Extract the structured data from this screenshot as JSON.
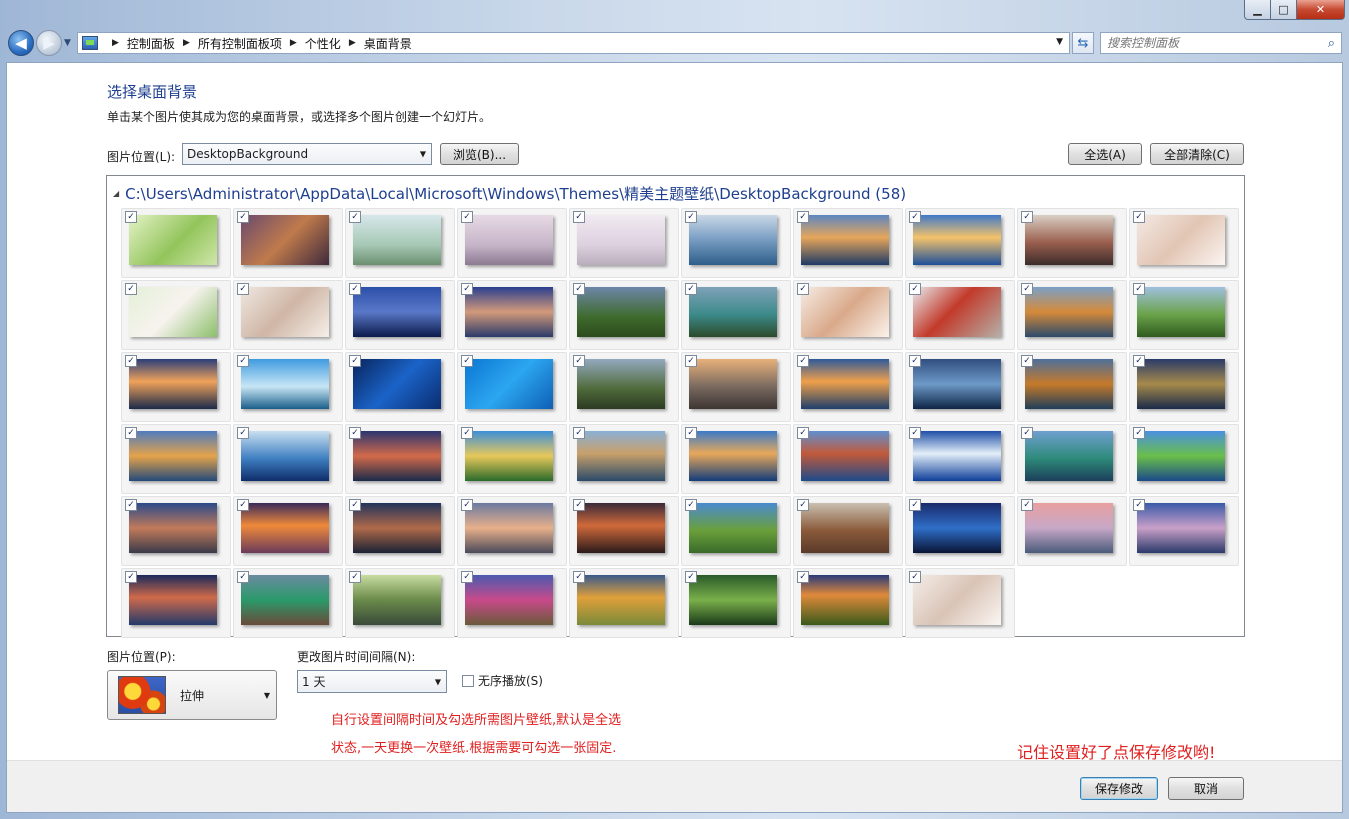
{
  "window": {
    "controls": {
      "minimize": "▁",
      "maximize": "□",
      "close": "✕"
    }
  },
  "nav": {
    "breadcrumbs": [
      "控制面板",
      "所有控制面板项",
      "个性化",
      "桌面背景"
    ],
    "search_placeholder": "搜索控制面板",
    "icons": {
      "back": "back-arrow-icon",
      "forward": "forward-arrow-icon",
      "refresh": "refresh-icon",
      "search": "search-icon"
    }
  },
  "page": {
    "title": "选择桌面背景",
    "subtitle": "单击某个图片使其成为您的桌面背景，或选择多个图片创建一个幻灯片。"
  },
  "location": {
    "label": "图片位置(L):",
    "value": "DesktopBackground",
    "browse": "浏览(B)...",
    "select_all": "全选(A)",
    "clear_all": "全部清除(C)"
  },
  "gallery": {
    "header": "C:\\Users\\Administrator\\AppData\\Local\\Microsoft\\Windows\\Themes\\精美主题壁纸\\DesktopBackground (58)",
    "count": 58,
    "checked": "✓",
    "thumbs": [
      "linear-gradient(135deg,#e4f3c6,#93c45c 55%,#cfe7a9)",
      "linear-gradient(135deg,#6a4a6e,#c07a4c 50%,#3f2a3c)",
      "linear-gradient(180deg,#d7e7ea,#a6c8b5 60%,#6b8f6f)",
      "linear-gradient(180deg,#e7d9e4,#c6b5c9 60%,#8b7a90)",
      "linear-gradient(180deg,#f1eaf1,#ddd0df 60%,#b9aebd)",
      "linear-gradient(180deg,#c9d7e6,#7fa2c6 45%,#2d5e8a)",
      "linear-gradient(180deg,#5d86c0,#e7a65a 45%,#1e3a66)",
      "linear-gradient(180deg,#3f79c8,#f5c36a 45%,#1c4f9a)",
      "linear-gradient(180deg,#d9cfc5,#9a5f4e 55%,#3c2c2a)",
      "linear-gradient(135deg,#f3e9e3,#e2c5b4 50%,#fbf5f1)",
      "linear-gradient(135deg,#e4f0d8,#f7f3ef 50%,#8cbf6a)",
      "linear-gradient(135deg,#efe7e0,#cfb6a6 50%,#f6efe8)",
      "linear-gradient(180deg,#2c4fa8,#5a78c9 50%,#0b1a4a)",
      "linear-gradient(180deg,#2a3f8f,#d39a7a 50%,#2a3a6a)",
      "linear-gradient(180deg,#6c86a8,#3f6b2d 60%,#2c4a1c)",
      "linear-gradient(180deg,#7fa2b8,#3c8a8a 55%,#2b4a2a)",
      "linear-gradient(135deg,#f6ece4,#d9a98a 50%,#fbf3ec)",
      "linear-gradient(135deg,#e9ecef,#c23a2a 45%,#b5b0a8)",
      "linear-gradient(180deg,#7ba0c6,#d68a3a 50%,#2b4a6a)",
      "linear-gradient(180deg,#9fc0de,#6aa34a 55%,#2f5a1e)",
      "linear-gradient(180deg,#2a3e7a,#f0a25a 45%,#1c2a4a)",
      "linear-gradient(180deg,#3f9be0,#c8e6f5 55%,#1a5e8a)",
      "linear-gradient(135deg,#08255e,#1b63c8 50%,#0a2d70)",
      "linear-gradient(135deg,#0b76d2,#2ca6f0 50%,#0e5fb5)",
      "linear-gradient(180deg,#93a9bf,#4f6a3a 60%,#2b3a22)",
      "linear-gradient(180deg,#e8b07a,#7a6a60 55%,#3d3532)",
      "linear-gradient(180deg,#2e5a9a,#f0a04a 45%,#1d3e6a)",
      "linear-gradient(180deg,#314f80,#6d9ac8 50%,#0e2545)",
      "linear-gradient(180deg,#4d6f9a,#c67a2a 50%,#1f3e5a)",
      "linear-gradient(180deg,#2a3b6a,#a68a4a 50%,#1a2a4a)",
      "linear-gradient(180deg,#4f7bbe,#e5a34a 50%,#234a7a)",
      "linear-gradient(180deg,#c9dff0,#3f7fc2 55%,#0e2d6a)",
      "linear-gradient(180deg,#2a3570,#d36a4a 50%,#1a2a4a)",
      "linear-gradient(180deg,#3d8fd9,#e7c85a 50%,#2a6a2a)",
      "linear-gradient(180deg,#8ab0d6,#c9a06a 45%,#2a4a6a)",
      "linear-gradient(180deg,#3a7ac8,#e8a85a 45%,#123c7a)",
      "linear-gradient(180deg,#5f8fd0,#c25a3a 45%,#1e4a8a)",
      "linear-gradient(180deg,#1f4fa8,#e3eef8 45%,#0e3f9a)",
      "linear-gradient(180deg,#6fa0d0,#2e8a7a 55%,#1b3f5a)",
      "linear-gradient(180deg,#4a90e0,#6abf4a 50%,#1b4a8a)",
      "linear-gradient(180deg,#2a4a8a,#c27a5a 50%,#3a3a4a)",
      "linear-gradient(180deg,#3a2a5a,#f08a3a 45%,#6a3a5a)",
      "linear-gradient(180deg,#22335a,#b06a4a 50%,#1a2235)",
      "linear-gradient(180deg,#6a7aa0,#e8b08a 50%,#4a4a5a)",
      "linear-gradient(180deg,#3a2a3a,#d06a3a 45%,#2a1a1a)",
      "linear-gradient(180deg,#4a8ad0,#6aa03a 55%,#3a6a2a)",
      "linear-gradient(180deg,#c9bfb0,#8a5a3a 55%,#5a3a2a)",
      "linear-gradient(180deg,#1a2a6a,#2f6fc8 50%,#0a1535)",
      "linear-gradient(180deg,#e8a0a0,#c8a8c8 50%,#4a5a7a)",
      "linear-gradient(180deg,#3a5aa8,#c9a0c8 50%,#2a3a6a)",
      "linear-gradient(180deg,#1a2a5a,#d06a4a 45%,#233a6a)",
      "linear-gradient(180deg,#6a8aa0,#2a9a6a 50%,#6a4a3a)",
      "linear-gradient(180deg,#c8dca0,#6a8a4a 50%,#3a4a3a)",
      "linear-gradient(180deg,#4a5ab0,#c84a8a 50%,#6a5a3a)",
      "linear-gradient(180deg,#3a5a8a,#e0a03a 45%,#7a8a3a)",
      "linear-gradient(180deg,#2a5a2a,#7ab04a 50%,#1a3a1a)",
      "linear-gradient(180deg,#2a3a7a,#e08a3a 40%,#3a5a1a)",
      "linear-gradient(135deg,#f4ede8,#d9c3b6 50%,#fbf6f2)"
    ]
  },
  "position": {
    "label": "图片位置(P):",
    "value": "拉伸"
  },
  "interval": {
    "label": "更改图片时间间隔(N):",
    "value": "1 天",
    "shuffle": "无序播放(S)"
  },
  "notes": {
    "instruction": "自行设置间隔时间及勾选所需图片壁纸,默认是全选状态,一天更换一次壁纸.根据需要可勾选一张固定.",
    "reminder": "记住设置好了点保存修改哟!"
  },
  "footer": {
    "save": "保存修改",
    "cancel": "取消"
  }
}
